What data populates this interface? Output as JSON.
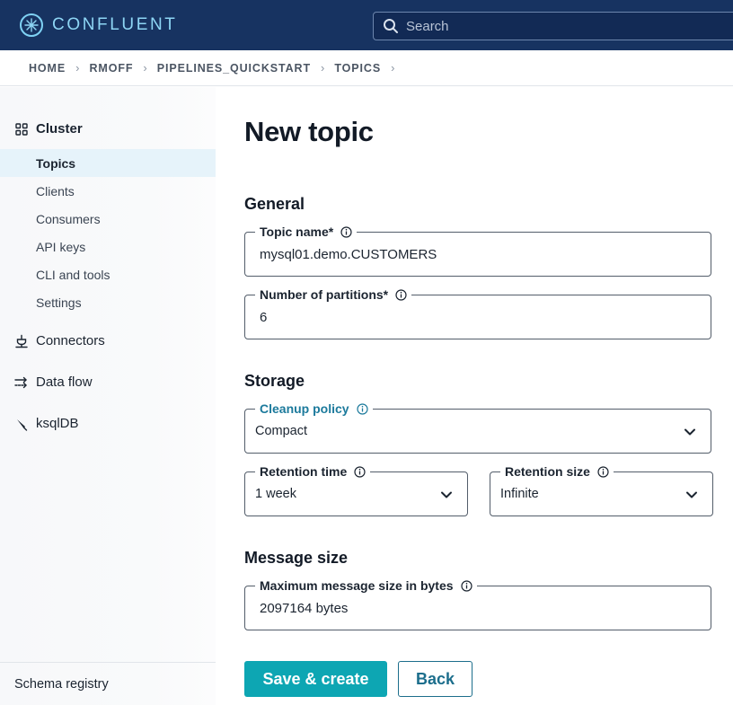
{
  "header": {
    "brand": "CONFLUENT",
    "search_placeholder": "Search"
  },
  "breadcrumb": [
    "HOME",
    "RMOFF",
    "PIPELINES_QUICKSTART",
    "TOPICS"
  ],
  "sidebar": {
    "cluster_label": "Cluster",
    "cluster_items": [
      {
        "label": "Topics",
        "active": true
      },
      {
        "label": "Clients",
        "active": false
      },
      {
        "label": "Consumers",
        "active": false
      },
      {
        "label": "API keys",
        "active": false
      },
      {
        "label": "CLI and tools",
        "active": false
      },
      {
        "label": "Settings",
        "active": false
      }
    ],
    "connectors_label": "Connectors",
    "dataflow_label": "Data flow",
    "ksqldb_label": "ksqlDB",
    "footer_label": "Schema registry"
  },
  "main": {
    "title": "New topic",
    "general": {
      "heading": "General",
      "topic_name_label": "Topic name*",
      "topic_name_value": "mysql01.demo.CUSTOMERS",
      "partitions_label": "Number of partitions*",
      "partitions_value": "6"
    },
    "storage": {
      "heading": "Storage",
      "cleanup_label": "Cleanup policy",
      "cleanup_value": "Compact",
      "retention_time_label": "Retention time",
      "retention_time_value": "1 week",
      "retention_size_label": "Retention size",
      "retention_size_value": "Infinite"
    },
    "message_size": {
      "heading": "Message size",
      "max_label": "Maximum message size in bytes",
      "max_value": "2097164 bytes"
    },
    "buttons": {
      "save": "Save & create",
      "back": "Back"
    }
  },
  "colors": {
    "header_bg": "#173361",
    "accent": "#0da6b3",
    "link": "#1c7a9c",
    "active_item_bg": "#e6f3fa"
  }
}
